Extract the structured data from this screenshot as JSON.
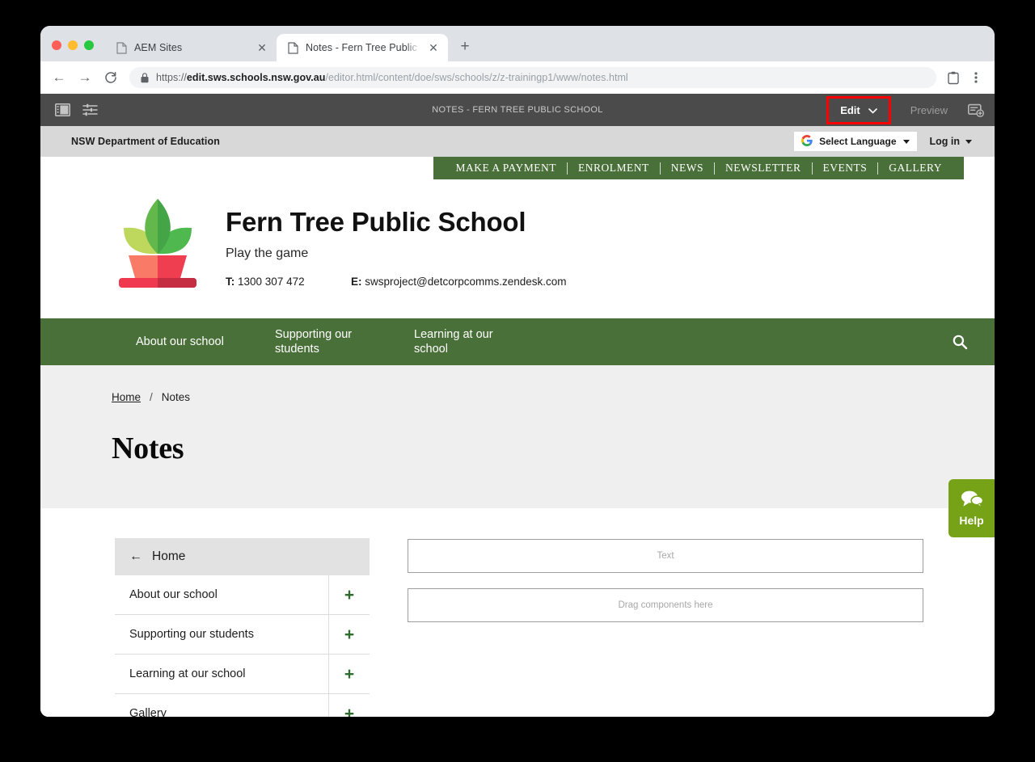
{
  "browser": {
    "tabs": [
      {
        "title": "AEM Sites",
        "active": false,
        "favicon": "page-icon"
      },
      {
        "title": "Notes - Fern Tree Public Schoo",
        "active": true,
        "favicon": "page-icon"
      }
    ],
    "new_tab_label": "+",
    "nav": {
      "back_label": "←",
      "forward_label": "→",
      "reload_label": "⟳"
    },
    "address": {
      "scheme": "https://",
      "domain": "edit.sws.schools.nsw.gov.au",
      "path": "/editor.html/content/doe/sws/schools/z/z-trainingp1/www/notes.html",
      "lock_icon": "lock-icon"
    },
    "actions": {
      "profile_icon": "profile-card-icon",
      "menu_icon": "kebab-menu-icon"
    }
  },
  "aem_toolbar": {
    "sidepanel_icon": "side-panel-toggle-icon",
    "page_info_icon": "page-properties-icon",
    "page_title": "NOTES - FERN TREE PUBLIC SCHOOL",
    "edit_label": "Edit",
    "edit_caret": "⌄",
    "preview_label": "Preview",
    "annotate_icon": "add-annotation-icon",
    "highlight_color": "#ff0000"
  },
  "site_utility": {
    "department": "NSW Department of Education",
    "language_selector": "Select Language",
    "language_icon": "google-g-icon",
    "login_label": "Log in"
  },
  "quicklinks": [
    "MAKE A PAYMENT",
    "ENROLMENT",
    "NEWS",
    "NEWSLETTER",
    "EVENTS",
    "GALLERY"
  ],
  "school": {
    "logo_icon": "plant-pot-logo",
    "name": "Fern Tree Public School",
    "tagline": "Play the game",
    "phone_label": "T:",
    "phone": "1300 307 472",
    "email_label": "E:",
    "email": "swsproject@detcorpcomms.zendesk.com"
  },
  "main_nav": {
    "items": [
      "About our school",
      "Supporting our\nstudents",
      "Learning at our\nschool"
    ],
    "search_icon": "search-icon"
  },
  "page": {
    "breadcrumb": {
      "home": "Home",
      "separator": "/",
      "current": "Notes"
    },
    "title": "Notes"
  },
  "side_nav": {
    "home_label": "Home",
    "back_icon": "arrow-left-icon",
    "items": [
      {
        "label": "About our school",
        "expand": "+"
      },
      {
        "label": "Supporting our students",
        "expand": "+"
      },
      {
        "label": "Learning at our school",
        "expand": "+"
      },
      {
        "label": "Gallery",
        "expand": "+"
      }
    ]
  },
  "dropzones": [
    {
      "label": "Text"
    },
    {
      "label": "Drag components here"
    }
  ],
  "help": {
    "label": "Help",
    "icon": "chat-bubbles-icon",
    "color": "#76a218"
  },
  "colors": {
    "school_green": "#4a7039",
    "help_green": "#76a218",
    "toolbar_gray": "#4b4b4b",
    "highlight_red": "#ff0000",
    "plus_green": "#2e6b2e"
  }
}
